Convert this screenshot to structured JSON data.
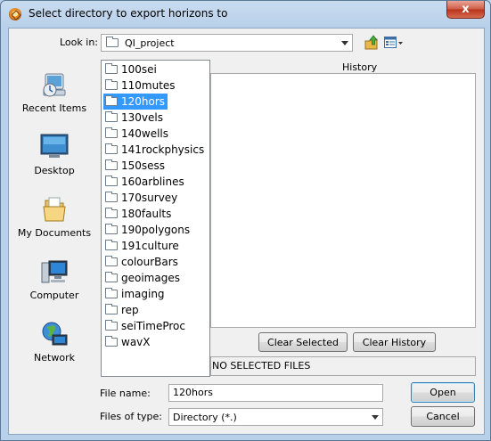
{
  "window": {
    "title": "Select directory to export horizons to",
    "close_glyph": "x"
  },
  "look_in": {
    "label": "Look in:",
    "value": "QI_project"
  },
  "sidebar": {
    "items": [
      {
        "label": "Recent Items",
        "icon": "recent-items-icon"
      },
      {
        "label": "Desktop",
        "icon": "desktop-icon"
      },
      {
        "label": "My Documents",
        "icon": "my-documents-icon"
      },
      {
        "label": "Computer",
        "icon": "computer-icon"
      },
      {
        "label": "Network",
        "icon": "network-icon"
      }
    ]
  },
  "folders": [
    {
      "name": "100sei",
      "selected": false
    },
    {
      "name": "110mutes",
      "selected": false
    },
    {
      "name": "120hors",
      "selected": true
    },
    {
      "name": "130vels",
      "selected": false
    },
    {
      "name": "140wells",
      "selected": false
    },
    {
      "name": "141rockphysics",
      "selected": false
    },
    {
      "name": "150sess",
      "selected": false
    },
    {
      "name": "160arblines",
      "selected": false
    },
    {
      "name": "170survey",
      "selected": false
    },
    {
      "name": "180faults",
      "selected": false
    },
    {
      "name": "190polygons",
      "selected": false
    },
    {
      "name": "191culture",
      "selected": false
    },
    {
      "name": "colourBars",
      "selected": false
    },
    {
      "name": "geoimages",
      "selected": false
    },
    {
      "name": "imaging",
      "selected": false
    },
    {
      "name": "rep",
      "selected": false
    },
    {
      "name": "seiTimeProc",
      "selected": false
    },
    {
      "name": "wavX",
      "selected": false
    }
  ],
  "history": {
    "title": "History",
    "clear_selected": "Clear Selected",
    "clear_history": "Clear History",
    "status": "NO SELECTED FILES"
  },
  "file_name": {
    "label": "File name:",
    "value": "120hors"
  },
  "file_type": {
    "label": "Files of type:",
    "value": "Directory (*.)"
  },
  "buttons": {
    "open": "Open",
    "cancel": "Cancel"
  }
}
